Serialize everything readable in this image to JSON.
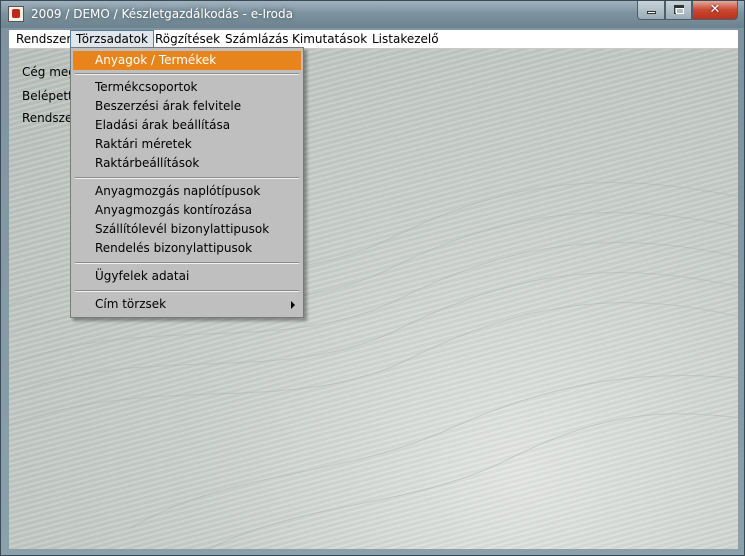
{
  "window": {
    "title": "2009 / DEMO / Készletgazdálkodás - e-Iroda",
    "controls": {
      "close": "✕"
    }
  },
  "menubar": {
    "items": [
      {
        "label": "Rendszer"
      },
      {
        "label": "Törzsadatok",
        "active": true
      },
      {
        "label": "Rögzítések"
      },
      {
        "label": "Számlázás"
      },
      {
        "label": "Kimutatások"
      },
      {
        "label": "Listakezelő"
      }
    ]
  },
  "client": {
    "labels": [
      "Cég meg",
      "Belépett",
      "Rendsze"
    ]
  },
  "dropdown": {
    "items": [
      "Anyagok / Termékek",
      "Termékcsoportok",
      "Beszerzési árak felvitele",
      "Eladási árak beállítása",
      "Raktári méretek",
      "Raktárbeállítások",
      "Anyagmozgás naplótípusok",
      "Anyagmozgás kontírozása",
      "Szállítólevél bizonylattipusok",
      "Rendelés bizonylattipusok",
      "Ügyfelek adatai",
      "Cím törzsek"
    ],
    "highlighted_index": 0,
    "highlight_color": "#e8841c"
  }
}
